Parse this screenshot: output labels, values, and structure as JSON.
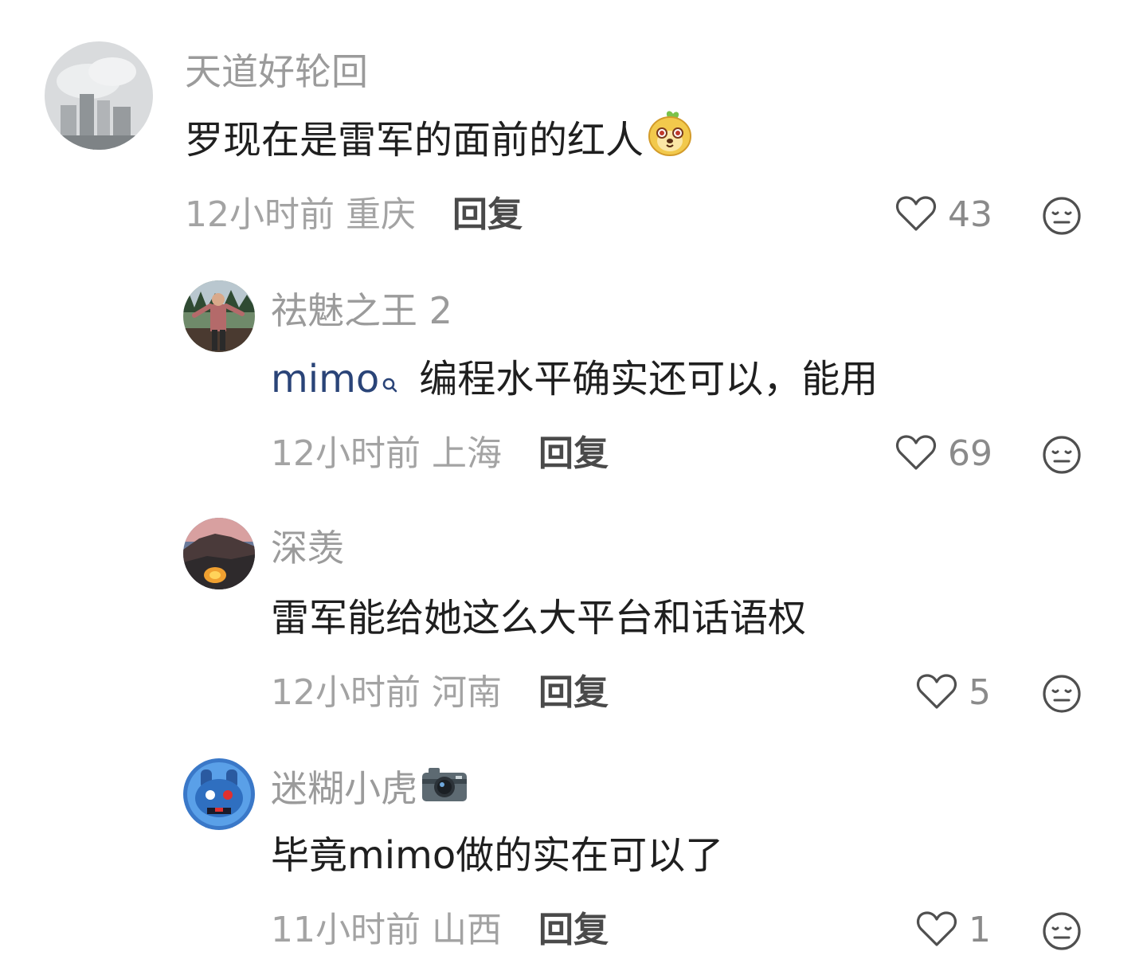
{
  "comments": [
    {
      "username": "天道好轮回",
      "content": "罗现在是雷军的面前的红人",
      "time": "12小时前",
      "location": "重庆",
      "reply_label": "回复",
      "likes": "43",
      "sticker": "dog-face-sticker"
    },
    {
      "username": "祛魅之王 2",
      "mention": "mimo",
      "content": "编程水平确实还可以，能用",
      "time": "12小时前",
      "location": "上海",
      "reply_label": "回复",
      "likes": "69"
    },
    {
      "username": "深羡",
      "content": "雷军能给她这么大平台和话语权",
      "time": "12小时前",
      "location": "河南",
      "reply_label": "回复",
      "likes": "5"
    },
    {
      "username": "迷糊小虎",
      "username_emoji": "📷",
      "content": "毕竟mimo做的实在可以了",
      "time": "11小时前",
      "location": "山西",
      "reply_label": "回复",
      "likes": "1"
    }
  ],
  "icons": {
    "like": "heart-outline-icon",
    "dislike": "neutral-face-icon",
    "mention": "search-icon"
  },
  "colors": {
    "username": "#9b9b9b",
    "content": "#1f1f1f",
    "mention": "#2a4478",
    "meta": "#a3a3a3",
    "reply": "#4a4a4a"
  }
}
